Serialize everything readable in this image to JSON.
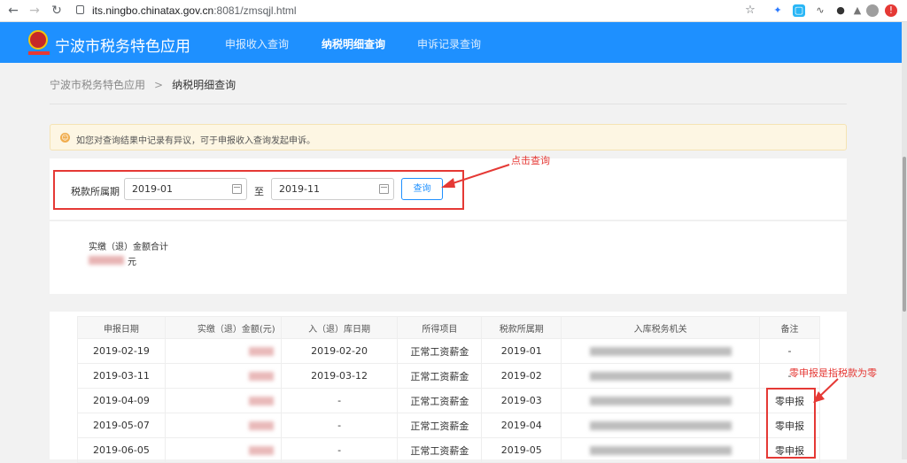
{
  "browser": {
    "url_host": "its.ningbo.chinatax.gov.cn",
    "url_rest": ":8081/zmsqjl.html"
  },
  "header": {
    "app_title": "宁波市税务特色应用",
    "nav": [
      {
        "label": "申报收入查询",
        "active": false
      },
      {
        "label": "纳税明细查询",
        "active": true
      },
      {
        "label": "申诉记录查询",
        "active": false
      }
    ]
  },
  "breadcrumb": {
    "home": "宁波市税务特色应用",
    "separator": ">",
    "current": "纳税明细查询"
  },
  "notice": {
    "text": "如您对查询结果中记录有异议，可于申报收入查询发起申诉。"
  },
  "search": {
    "period_label": "税款所属期",
    "start_date": "2019-01",
    "to_label": "至",
    "end_date": "2019-11",
    "query_button": "查询"
  },
  "summary": {
    "label": "实缴（退）金额合计",
    "unit": "元"
  },
  "table": {
    "columns": [
      "申报日期",
      "实缴（退）金额(元)",
      "入（退）库日期",
      "所得项目",
      "税款所属期",
      "入库税务机关",
      "备注"
    ],
    "rows": [
      {
        "date": "2019-02-19",
        "store_date": "2019-02-20",
        "item": "正常工资薪金",
        "period": "2019-01",
        "note": "-"
      },
      {
        "date": "2019-03-11",
        "store_date": "2019-03-12",
        "item": "正常工资薪金",
        "period": "2019-02",
        "note": "-"
      },
      {
        "date": "2019-04-09",
        "store_date": "-",
        "item": "正常工资薪金",
        "period": "2019-03",
        "note": "零申报"
      },
      {
        "date": "2019-05-07",
        "store_date": "-",
        "item": "正常工资薪金",
        "period": "2019-04",
        "note": "零申报"
      },
      {
        "date": "2019-06-05",
        "store_date": "-",
        "item": "正常工资薪金",
        "period": "2019-05",
        "note": "零申报"
      }
    ]
  },
  "annotations": {
    "click_query": "点击查询",
    "zero_declaration": "零申报是指税款为零"
  },
  "colors": {
    "brand": "#1e90ff",
    "annotation": "#e53935",
    "notice_bg": "#fdf6e3"
  }
}
